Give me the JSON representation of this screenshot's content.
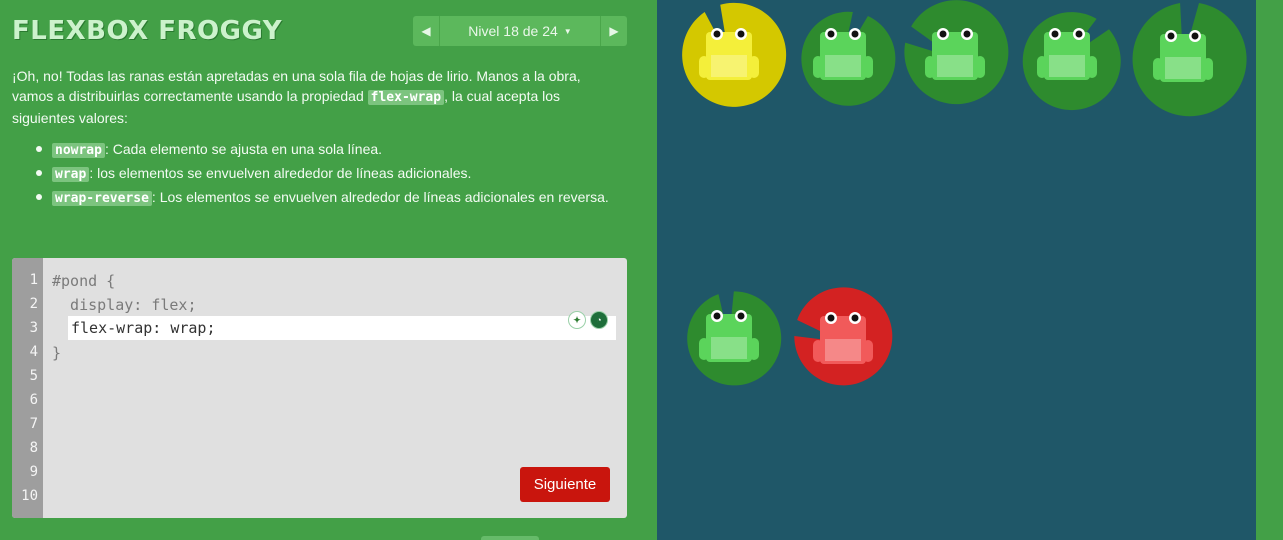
{
  "app": {
    "title": "FLEXBOX FROGGY"
  },
  "level_nav": {
    "label": "Nivel 18 de 24",
    "prev_icon": "triangle-left-icon",
    "next_icon": "triangle-right-icon",
    "caret_icon": "caret-down-icon"
  },
  "instructions": {
    "intro_part1": "¡Oh, no! Todas las ranas están apretadas en una sola fila de hojas de lirio. Manos a la obra, vamos a distribuirlas correctamente usando la propiedad ",
    "intro_keyword": "flex-wrap",
    "intro_part2": ", la cual acepta los siguientes valores:",
    "values": [
      {
        "keyword": "nowrap",
        "desc": ": Cada elemento se ajusta en una sola línea."
      },
      {
        "keyword": "wrap",
        "desc": ": los elementos se envuelven alrededor de líneas adicionales."
      },
      {
        "keyword": "wrap-reverse",
        "desc": ": Los elementos se envuelven alrededor de líneas adicionales en reversa."
      }
    ]
  },
  "editor": {
    "line_numbers": [
      "1",
      "2",
      "3",
      "4",
      "5",
      "6",
      "7",
      "8",
      "9",
      "10"
    ],
    "line1": "#pond {",
    "line2": "  display: flex;",
    "input_value": "flex-wrap: wrap;",
    "line4": "}",
    "next_button": "Siguiente"
  },
  "pond": {
    "pads": [
      {
        "color": "yellow",
        "row": 1
      },
      {
        "color": "green",
        "row": 1
      },
      {
        "color": "green",
        "row": 1
      },
      {
        "color": "green",
        "row": 1
      },
      {
        "color": "green",
        "row": 1
      },
      {
        "color": "green",
        "row": 2
      },
      {
        "color": "red",
        "row": 2
      }
    ],
    "frogs": [
      {
        "color": "yellow",
        "row": 1
      },
      {
        "color": "green",
        "row": 1
      },
      {
        "color": "green",
        "row": 1
      },
      {
        "color": "green",
        "row": 1
      },
      {
        "color": "green",
        "row": 1
      },
      {
        "color": "green",
        "row": 2
      },
      {
        "color": "red",
        "row": 2
      }
    ]
  },
  "colors": {
    "panel_green": "#43a047",
    "pond_blue": "#1f5768",
    "next_red": "#c9150d",
    "pad_yellow": "#d4c800",
    "pad_green": "#2e8b2e",
    "pad_red": "#d32222",
    "frog_yellow": "#f4ef3a",
    "frog_green": "#5bd45b",
    "frog_red": "#f15a5a"
  }
}
